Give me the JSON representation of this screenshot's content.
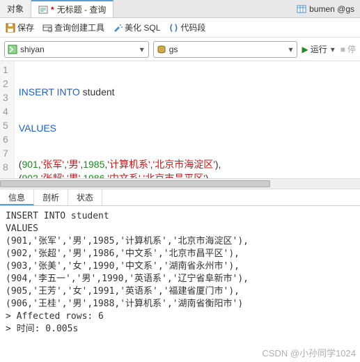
{
  "tabs": {
    "object": "对象",
    "active_title": "无标题 - 查询",
    "active_dirty": "*",
    "right_title": "bumen @gs"
  },
  "toolbar": {
    "save": "保存",
    "queryBuilder": "查询创建工具",
    "beautify": "美化 SQL",
    "snippet": "代码段"
  },
  "combos": {
    "db": "shiyan",
    "schema": "gs",
    "run": "运行",
    "stop": "停"
  },
  "editor": {
    "lines": [
      "1",
      "2",
      "3",
      "4",
      "5",
      "6",
      "7",
      "8"
    ],
    "kw_insert": "INSERT INTO",
    "ident_student": " student",
    "kw_values": "VALUES",
    "rows": [
      {
        "open": "(",
        "n": "901",
        "c1": ",",
        "s1": "'张军'",
        "c2": ",",
        "s2": "'男'",
        "c3": ",",
        "y": "1985",
        "c4": ",",
        "s3": "'计算机系'",
        "c5": ",",
        "s4": "'北京市海淀区'",
        "close": "),"
      },
      {
        "open": "(",
        "n": "902",
        "c1": ",",
        "s1": "'张超'",
        "c2": ",",
        "s2": "'男'",
        "c3": ",",
        "y": "1986",
        "c4": ",",
        "s3": "'中文系'",
        "c5": ",",
        "s4": "'北京市昌平区'",
        "close": "),"
      },
      {
        "open": "(",
        "n": "903",
        "c1": ",",
        "s1": "'张美'",
        "c2": ",",
        "s2": "'女'",
        "c3": ",",
        "y": "1990",
        "c4": ",",
        "s3": "'中文系'",
        "c5": ",",
        "s4": "'湖南省永州市'",
        "close": "),"
      },
      {
        "open": "(",
        "n": "904",
        "c1": ",",
        "s1": "'李五一'",
        "c2": ",",
        "s2": "'男'",
        "c3": ",",
        "y": "1990",
        "c4": ",",
        "s3": "'英语系'",
        "c5": ",",
        "s4": "'辽宁省阜新市'",
        "close": "),"
      },
      {
        "open": "(",
        "n": "905",
        "c1": ",",
        "s1": "'王芳'",
        "c2": ",",
        "s2": "'女'",
        "c3": ",",
        "y": "1991",
        "c4": ",",
        "s3": "'英语系'",
        "c5": ",",
        "s4": "'福建省厦门市'",
        "close": "),"
      },
      {
        "open": "(",
        "n": "906",
        "c1": ",",
        "s1": "'王桂'",
        "c2": ",",
        "s2": "'男'",
        "c3": ",",
        "y": "1988",
        "c4": ",",
        "s3": "'计算机系'",
        "c5": ",",
        "s4": "'湖南省衡阳市'",
        "close": ");"
      }
    ]
  },
  "resultTabs": {
    "info": "信息",
    "profile": "剖析",
    "status": "状态"
  },
  "output": "INSERT INTO student\nVALUES\n(901,'张军','男',1985,'计算机系','北京市海淀区'),\n(902,'张超','男',1986,'中文系','北京市昌平区'),\n(903,'张美','女',1990,'中文系','湖南省永州市'),\n(904,'李五一','男',1990,'英语系','辽宁省阜新市'),\n(905,'王芳','女',1991,'英语系','福建省厦门市'),\n(906,'王桂','男',1988,'计算机系','湖南省衡阳市')\n> Affected rows: 6\n> 时间: 0.005s",
  "watermark": "CSDN @小孙同学1024"
}
